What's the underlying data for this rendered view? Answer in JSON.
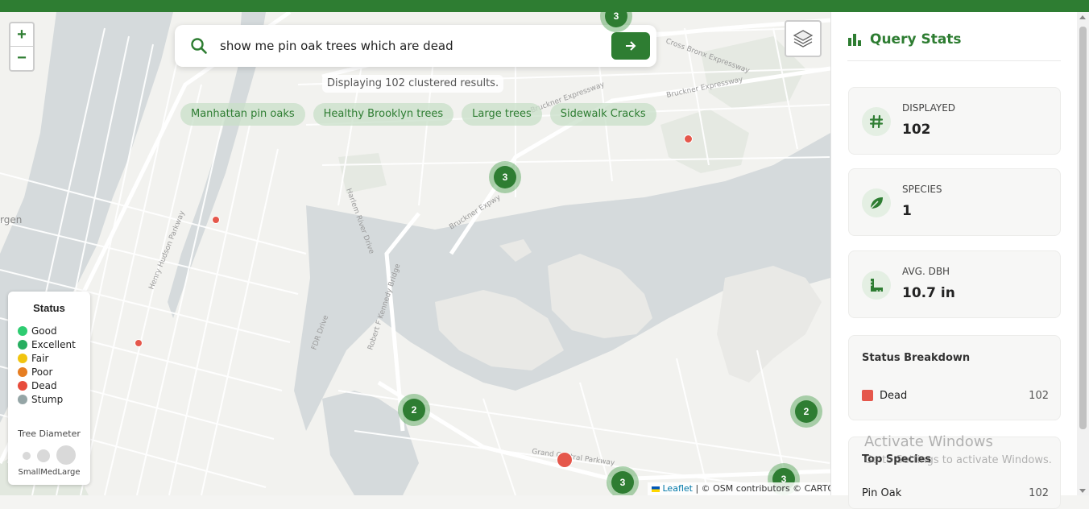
{
  "map": {
    "zoom_in": "+",
    "zoom_out": "−",
    "search_value": "show me pin oak trees which are dead",
    "result_text": "Displaying 102 clustered results.",
    "chips": [
      "Manhattan pin oaks",
      "Healthy Brooklyn trees",
      "Large trees",
      "Sidewalk Cracks"
    ],
    "clusters": [
      "3",
      "2",
      "2",
      "3",
      "3"
    ],
    "place_fragment": "rgen",
    "street_labels": [
      "Cross Bronx Expressway",
      "Bruckner Expressway",
      "Bruckner Expwy",
      "Harlem River Drive",
      "Henry Hudson Parkway",
      "FDR Drive",
      "Robert F Kennedy Bridge",
      "Grand Central Parkway",
      "Bruckner Expressway"
    ],
    "attribution": {
      "leaflet": "Leaflet",
      "rest": " | © OSM contributors © CARTO"
    }
  },
  "legend": {
    "title": "Status",
    "items": [
      {
        "label": "Good",
        "color": "#2ecc71"
      },
      {
        "label": "Excellent",
        "color": "#27ae60"
      },
      {
        "label": "Fair",
        "color": "#f1c40f"
      },
      {
        "label": "Poor",
        "color": "#e67e22"
      },
      {
        "label": "Dead",
        "color": "#e74c3c"
      },
      {
        "label": "Stump",
        "color": "#95a5a6"
      }
    ],
    "diameter_title": "Tree Diameter",
    "size_labels": "SmallMedLarge"
  },
  "panel": {
    "title": "Query Stats",
    "stats": [
      {
        "label": "DISPLAYED",
        "value": "102",
        "icon": "hash-icon"
      },
      {
        "label": "SPECIES",
        "value": "1",
        "icon": "leaf-icon"
      },
      {
        "label": "AVG. DBH",
        "value": "10.7 in",
        "icon": "ruler-icon"
      }
    ],
    "breakdown": {
      "title": "Status Breakdown",
      "label": "Dead",
      "count": "102"
    },
    "top_species": {
      "title": "Top Species",
      "label": "Pin Oak",
      "count": "102"
    }
  },
  "watermark": {
    "line1": "Activate Windows",
    "line2": "Go to Settings to activate Windows."
  },
  "colors": {
    "brand": "#2e7d32",
    "dead": "#e5574b"
  }
}
